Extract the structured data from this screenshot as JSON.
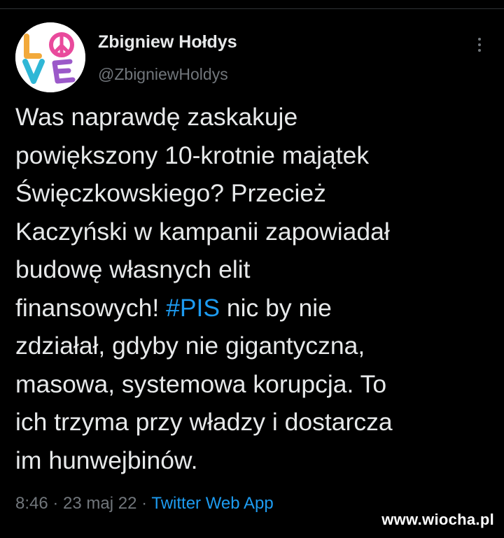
{
  "colors": {
    "background": "#000000",
    "text_primary": "#e7e9ea",
    "text_secondary": "#71767b",
    "accent": "#1d9bf0"
  },
  "author": {
    "display_name": "Zbigniew Hołdys",
    "handle": "@ZbigniewHoldys",
    "avatar_icon": "love-peace-avatar"
  },
  "tweet": {
    "lines": [
      {
        "text": "Was naprawdę zaskakuje"
      },
      {
        "text": "powiększony 10-krotnie majątek"
      },
      {
        "text": "Święczkowskiego? Przecież"
      },
      {
        "text": "Kaczyński w kampanii zapowiadał"
      },
      {
        "text": "budowę własnych elit"
      },
      {
        "before": "finansowych! ",
        "hashtag": "#PIS",
        "after": " nic by nie"
      },
      {
        "text": "zdziałał, gdyby nie gigantyczna,"
      },
      {
        "text": "masowa, systemowa korupcja. To"
      },
      {
        "text": "ich trzyma przy władzy i dostarcza"
      },
      {
        "text": "im hunwejbinów."
      }
    ]
  },
  "meta": {
    "time": "8:46",
    "separator": " · ",
    "date": "23 maj 22",
    "source": "Twitter Web App"
  },
  "more_icon": "more-options-icon",
  "watermark": "www.wiocha.pl"
}
